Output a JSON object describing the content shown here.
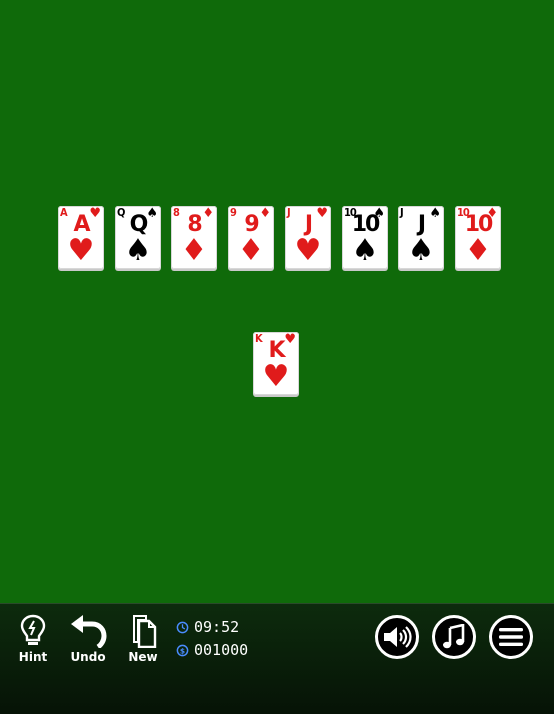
{
  "tableau": [
    {
      "rank": "A",
      "suit": "hearts",
      "symbol": "♥",
      "color": "#e01b1b"
    },
    {
      "rank": "Q",
      "suit": "spades",
      "symbol": "♠",
      "color": "#000000"
    },
    {
      "rank": "8",
      "suit": "diamonds",
      "symbol": "♦",
      "color": "#e01b1b"
    },
    {
      "rank": "9",
      "suit": "diamonds",
      "symbol": "♦",
      "color": "#e01b1b"
    },
    {
      "rank": "J",
      "suit": "hearts",
      "symbol": "♥",
      "color": "#e01b1b"
    },
    {
      "rank": "10",
      "suit": "spades",
      "symbol": "♠",
      "color": "#000000"
    },
    {
      "rank": "J",
      "suit": "spades",
      "symbol": "♠",
      "color": "#000000"
    },
    {
      "rank": "10",
      "suit": "diamonds",
      "symbol": "♦",
      "color": "#e01b1b"
    }
  ],
  "stock_card": {
    "rank": "K",
    "suit": "hearts",
    "symbol": "♥",
    "color": "#e01b1b"
  },
  "toolbar": {
    "hint_label": "Hint",
    "undo_label": "Undo",
    "new_label": "New",
    "time": "09:52",
    "score": "001000"
  },
  "icons": {
    "hint": "lightbulb-icon",
    "undo": "undo-arrow-icon",
    "new": "new-deck-icon",
    "time": "clock-icon",
    "score": "coin-icon",
    "sound": "speaker-icon",
    "music": "music-note-icon",
    "menu": "hamburger-menu-icon"
  },
  "colors": {
    "felt": "#0f6a0a",
    "red_suit": "#e01b1b",
    "black_suit": "#000000",
    "toolbar": "#0d2b0d"
  }
}
